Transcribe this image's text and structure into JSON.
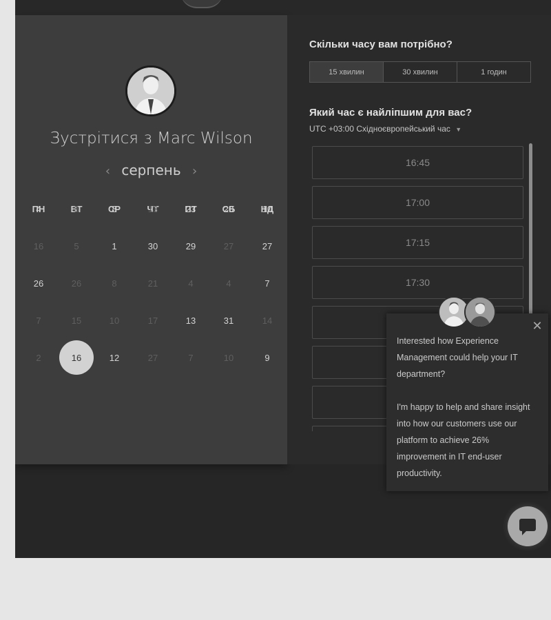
{
  "host": {
    "prefix": "Зустрітися з",
    "name": "Marc Wilson"
  },
  "calendar": {
    "month": "серпень",
    "weekdays": [
      "ПН",
      "ВТ",
      "СР",
      "ЧТ",
      "ПТ",
      "СБ",
      "НД"
    ],
    "rows": [
      [
        {
          "d": "4",
          "s": "on"
        },
        {
          "d": "8",
          "s": "off"
        },
        {
          "d": "8",
          "s": "on"
        },
        {
          "d": "13",
          "s": "off"
        },
        {
          "d": "23",
          "s": "on"
        },
        {
          "d": "20",
          "s": "on"
        },
        {
          "d": "10",
          "s": "on"
        }
      ],
      [
        {
          "d": "16",
          "s": "off"
        },
        {
          "d": "5",
          "s": "off"
        },
        {
          "d": "1",
          "s": "on"
        },
        {
          "d": "30",
          "s": "on"
        },
        {
          "d": "29",
          "s": "on"
        },
        {
          "d": "27",
          "s": "off"
        },
        {
          "d": "27",
          "s": "on"
        }
      ],
      [
        {
          "d": "26",
          "s": "on"
        },
        {
          "d": "26",
          "s": "off"
        },
        {
          "d": "8",
          "s": "off"
        },
        {
          "d": "21",
          "s": "off"
        },
        {
          "d": "4",
          "s": "off"
        },
        {
          "d": "4",
          "s": "off"
        },
        {
          "d": "7",
          "s": "on"
        }
      ],
      [
        {
          "d": "7",
          "s": "off"
        },
        {
          "d": "15",
          "s": "off"
        },
        {
          "d": "10",
          "s": "off"
        },
        {
          "d": "17",
          "s": "off"
        },
        {
          "d": "13",
          "s": "on"
        },
        {
          "d": "31",
          "s": "on"
        },
        {
          "d": "14",
          "s": "off"
        }
      ],
      [
        {
          "d": "2",
          "s": "off"
        },
        {
          "d": "16",
          "s": "sel"
        },
        {
          "d": "12",
          "s": "on"
        },
        {
          "d": "27",
          "s": "off"
        },
        {
          "d": "7",
          "s": "off"
        },
        {
          "d": "10",
          "s": "off"
        },
        {
          "d": "9",
          "s": "on"
        }
      ]
    ]
  },
  "duration": {
    "heading": "Скільки часу вам потрібно?",
    "options": [
      "15 хвилин",
      "30 хвилин",
      "1 годин"
    ],
    "selected": "15 хвилин"
  },
  "time": {
    "heading": "Який час є найліпшим для вас?",
    "timezone": "UTC +03:00 Східноєвропейський час",
    "slots": [
      "16:45",
      "17:00",
      "17:15",
      "17:30",
      "",
      "",
      "",
      ""
    ]
  },
  "popup": {
    "paragraph1": "Interested how Experience Management could help your IT department?",
    "paragraph2": "I'm happy to help and share insight into how our customers use our platform to achieve 26% improvement in IT end-user productivity."
  }
}
